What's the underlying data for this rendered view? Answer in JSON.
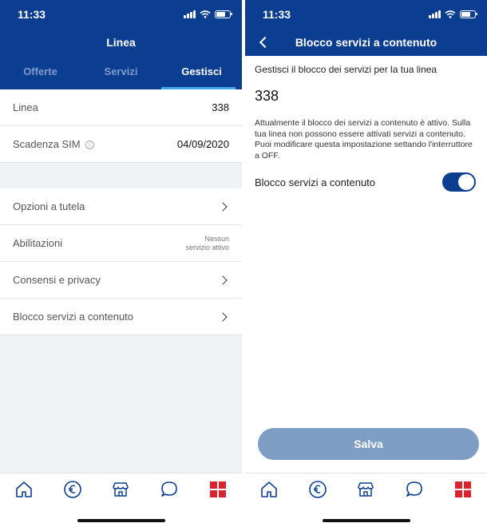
{
  "left": {
    "status_time": "11:33",
    "title": "Linea",
    "tabs": [
      {
        "label": "Offerte"
      },
      {
        "label": "Servizi"
      },
      {
        "label": "Gestisci"
      }
    ],
    "rows": [
      {
        "label": "Linea",
        "value": "338"
      },
      {
        "label": "Scadenza SIM",
        "value": "04/09/2020"
      }
    ],
    "menu": [
      {
        "label": "Opzioni a tutela"
      },
      {
        "label": "Abilitazioni",
        "note_line1": "Nessun",
        "note_line2": "servizio attivo"
      },
      {
        "label": "Consensi e privacy"
      },
      {
        "label": "Blocco servizi a contenuto"
      }
    ]
  },
  "right": {
    "status_time": "11:33",
    "title": "Blocco servizi a contenuto",
    "intro": "Gestisci il blocco dei servizi per la tua linea",
    "number": "338",
    "description": "Attualmente il blocco dei servizi a contenuto è attivo. Sulla tua linea non possono essere attivati servizi a contenuto.  Puoi modificare questa impostazione settando l'interruttore a OFF.",
    "toggle_label": "Blocco servizi a contenuto",
    "toggle_on": true,
    "save_label": "Salva"
  },
  "tabbar_icons": [
    "home-icon",
    "euro-icon",
    "store-icon",
    "chat-icon",
    "menu-grid-icon"
  ],
  "colors": {
    "brand": "#0b3e91",
    "accent": "#3fa7ea",
    "active_icon": "#d9232e"
  }
}
